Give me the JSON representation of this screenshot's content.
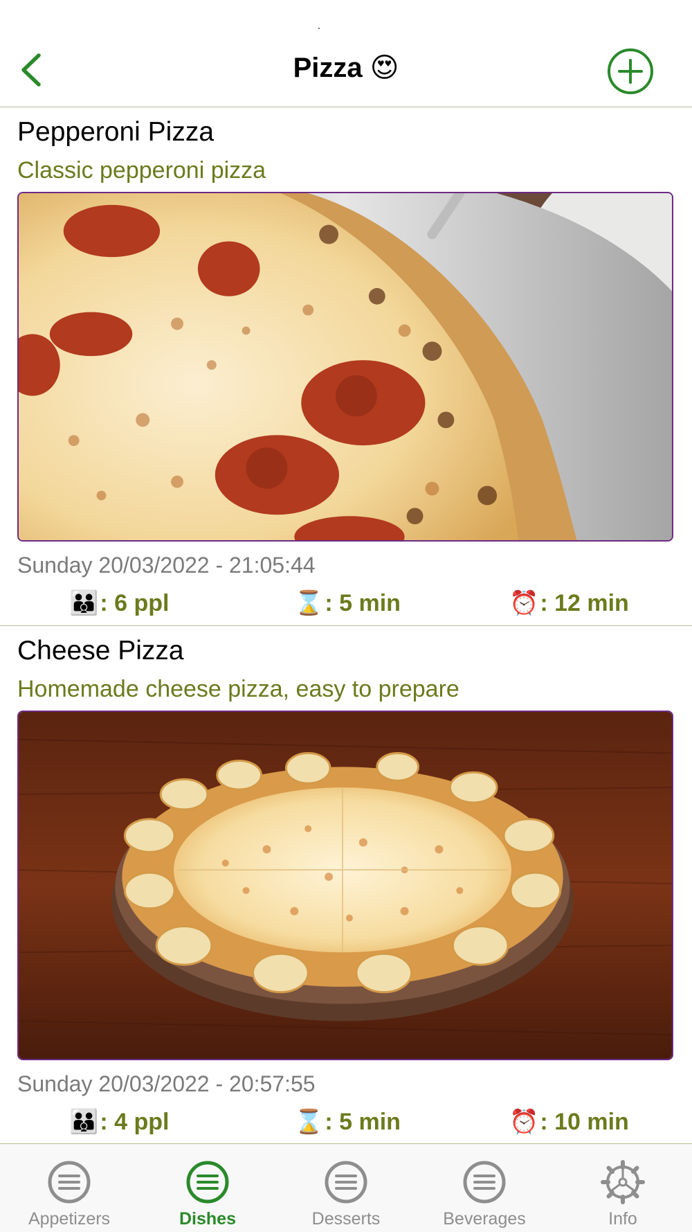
{
  "nav": {
    "title": "Pizza 😍",
    "back_icon": "chevron-left-icon",
    "add_icon": "plus-circle-icon",
    "accent": "#2a8a2a"
  },
  "recipes": [
    {
      "title": "Pepperoni Pizza",
      "subtitle": "Classic pepperoni pizza",
      "photo": "pepperoni-pizza-photo",
      "date": "Sunday 20/03/2022 - 21:05:44",
      "people_emoji": "👪",
      "people": ": 6 ppl",
      "prep_emoji": "⌛",
      "prep": ": 5 min",
      "cook_emoji": "⏰",
      "cook": ": 12 min"
    },
    {
      "title": "Cheese Pizza",
      "subtitle": "Homemade cheese pizza, easy to prepare",
      "photo": "cheese-pizza-photo",
      "date": "Sunday 20/03/2022 - 20:57:55",
      "people_emoji": "👪",
      "people": ": 4 ppl",
      "prep_emoji": "⌛",
      "prep": ": 5 min",
      "cook_emoji": "⏰",
      "cook": ": 10 min"
    }
  ],
  "tabs": [
    {
      "label": "Appetizers",
      "icon": "list-circle-icon",
      "active": false
    },
    {
      "label": "Dishes",
      "icon": "list-circle-icon",
      "active": true
    },
    {
      "label": "Desserts",
      "icon": "list-circle-icon",
      "active": false
    },
    {
      "label": "Beverages",
      "icon": "list-circle-icon",
      "active": false
    },
    {
      "label": "Info",
      "icon": "gear-icon",
      "active": false
    }
  ],
  "colors": {
    "subtitle": "#6c7a1d",
    "stat_text": "#6c7a1d",
    "separator": "#b7bd92",
    "photo_border": "#6d2a86",
    "tab_inactive": "#8e8e8e",
    "tab_active": "#2a8a2a"
  }
}
